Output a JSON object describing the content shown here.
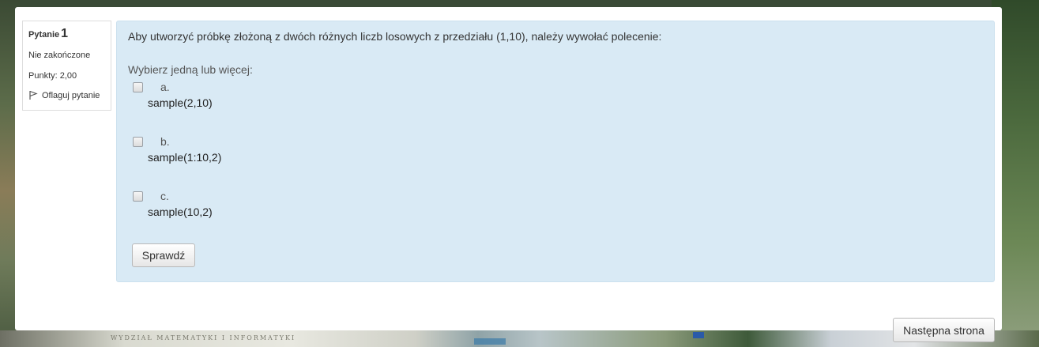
{
  "question_info": {
    "label": "Pytanie",
    "number": "1",
    "state": "Nie zakończone",
    "grade": "Punkty: 2,00",
    "flag_label": "Oflaguj pytanie"
  },
  "question": {
    "text": "Aby utworzyć próbkę złożoną z dwóch różnych liczb losowych z przedziału (1,10), należy wywołać polecenie:",
    "prompt": "Wybierz jedną lub więcej:",
    "answers": [
      {
        "letter": "a.",
        "text": "sample(2,10)"
      },
      {
        "letter": "b.",
        "text": "sample(1:10,2)"
      },
      {
        "letter": "c.",
        "text": "sample(10,2)"
      }
    ],
    "check_label": "Sprawdź"
  },
  "navigation": {
    "next_label": "Następna strona"
  },
  "background": {
    "caption": "WYDZIAŁ MATEMATYKI I INFORMATYKI"
  },
  "colors": {
    "content_bg": "#d9eaf5",
    "page_bg": "#ffffff"
  }
}
